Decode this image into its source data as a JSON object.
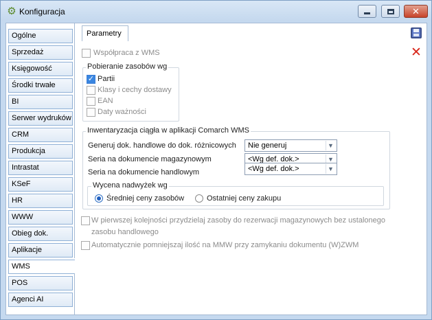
{
  "window": {
    "title": "Konfiguracja",
    "app_icon": "gear-icon",
    "controls": {
      "minimize": "minimize-icon",
      "maximize": "maximize-icon",
      "close": "close-icon"
    }
  },
  "nav": {
    "items": [
      {
        "label": "Ogólne"
      },
      {
        "label": "Sprzedaż"
      },
      {
        "label": "Księgowość"
      },
      {
        "label": "Środki trwałe"
      },
      {
        "label": "BI"
      },
      {
        "label": "Serwer wydruków"
      },
      {
        "label": "CRM"
      },
      {
        "label": "Produkcja"
      },
      {
        "label": "Intrastat"
      },
      {
        "label": "KSeF"
      },
      {
        "label": "HR"
      },
      {
        "label": "WWW"
      },
      {
        "label": "Obieg dok."
      },
      {
        "label": "Aplikacje"
      },
      {
        "label": "WMS"
      },
      {
        "label": "POS"
      },
      {
        "label": "Agenci AI"
      }
    ],
    "active": "WMS"
  },
  "tab": {
    "label": "Parametry"
  },
  "form": {
    "wms_coop": {
      "label": "Współpraca z WMS",
      "checked": false,
      "enabled": false
    },
    "pobieranie": {
      "legend": "Pobieranie zasobów wg",
      "items": [
        {
          "label": "Partii",
          "checked": true,
          "enabled": true
        },
        {
          "label": "Klasy i cechy dostawy",
          "checked": false,
          "enabled": false
        },
        {
          "label": "EAN",
          "checked": false,
          "enabled": false
        },
        {
          "label": "Daty ważności",
          "checked": false,
          "enabled": false
        }
      ]
    },
    "inwentaryzacja": {
      "legend": "Inwentaryzacja ciągła w aplikacji Comarch WMS",
      "rows": [
        {
          "label": "Generuj dok. handlowe do dok. różnicowych",
          "value": "Nie generuj"
        },
        {
          "label": "Seria na dokumencie magazynowym",
          "value": "<Wg def. dok.>"
        },
        {
          "label": "Seria na dokumencie handlowym",
          "value": "<Wg def. dok.>"
        }
      ],
      "wycena": {
        "legend": "Wycena nadwyżek wg",
        "options": [
          {
            "label": "Średniej ceny zasobów",
            "selected": true
          },
          {
            "label": "Ostatniej ceny zakupu",
            "selected": false
          }
        ]
      }
    },
    "przydzielaj": {
      "label_line1": "W pierwszej kolejności przydzielaj zasoby do rezerwacji magazynowych bez ustalonego",
      "label_line2": "zasobu handlowego",
      "checked": false,
      "enabled": false
    },
    "pomniejszaj": {
      "label": "Automatycznie pomniejszaj ilość na MMW przy zamykaniu dokumentu (W)ZWM",
      "checked": false,
      "enabled": false
    }
  },
  "toolbar": {
    "save_icon": "save-icon",
    "cancel_icon": "cancel-icon"
  },
  "colors": {
    "frame": "#c5d9ef",
    "accent": "#3a86e0",
    "cancel": "#d8261a"
  }
}
